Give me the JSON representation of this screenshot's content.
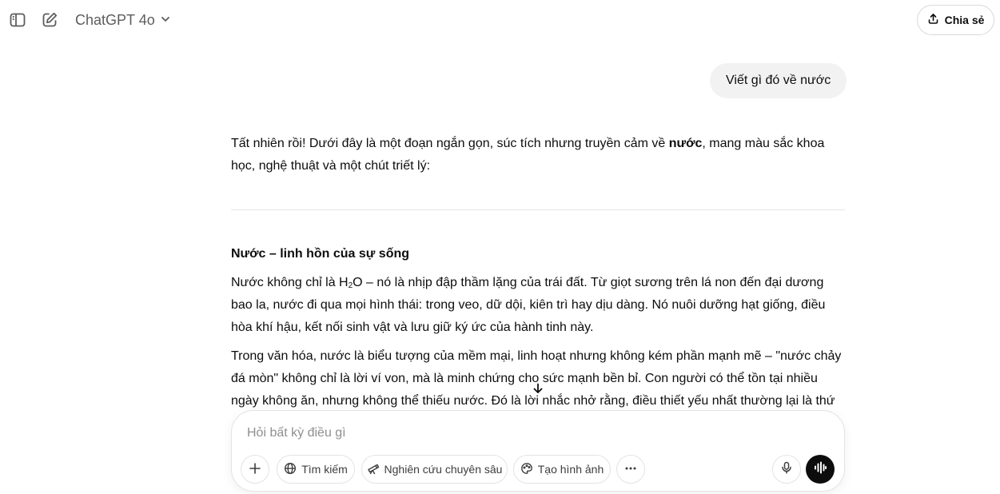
{
  "header": {
    "model_name": "ChatGPT 4o",
    "share_label": "Chia sẻ",
    "sidebar_icon": "sidebar-toggle-icon",
    "new_chat_icon": "new-chat-icon"
  },
  "conversation": {
    "user_message": "Viết gì đó về nước",
    "assistant": {
      "intro_before_bold": "Tất nhiên rồi! Dưới đây là một đoạn ngắn gọn, súc tích nhưng truyền cảm về ",
      "intro_bold": "nước",
      "intro_after_bold": ", mang màu sắc khoa học, nghệ thuật và một chút triết lý:",
      "section_title": "Nước – linh hồn của sự sống",
      "para1_a": "Nước không chỉ là H",
      "para1_sub": "2",
      "para1_b": "O – nó là nhịp đập thầm lặng của trái đất. Từ giọt sương trên lá non đến đại dương bao la, nước đi qua mọi hình thái: trong veo, dữ dội, kiên trì hay dịu dàng. Nó nuôi dưỡng hạt giống, điều hòa khí hậu, kết nối sinh vật và lưu giữ ký ức của hành tinh này.",
      "para2": "Trong văn hóa, nước là biểu tượng của mềm mại, linh hoạt nhưng không kém phần mạnh mẽ – \"nước chảy đá mòn\" không chỉ là lời ví von, mà là minh chứng cho sức mạnh bền bỉ. Con người có thể tồn tại nhiều ngày không ăn, nhưng không thể thiếu nước. Đó là lời nhắc nhở rằng, điều thiết yếu nhất thường lại là thứ"
    }
  },
  "composer": {
    "placeholder": "Hỏi bất kỳ điều gì",
    "tools": {
      "search": "Tìm kiếm",
      "deep_research": "Nghiên cứu chuyên sâu",
      "create_image": "Tạo hình ảnh"
    }
  },
  "colors": {
    "text": "#0d0d0d",
    "muted": "#5d5d5d",
    "bubble": "#f2f2f2",
    "border": "#e3e3e3",
    "voice_button": "#0d0d0d"
  }
}
